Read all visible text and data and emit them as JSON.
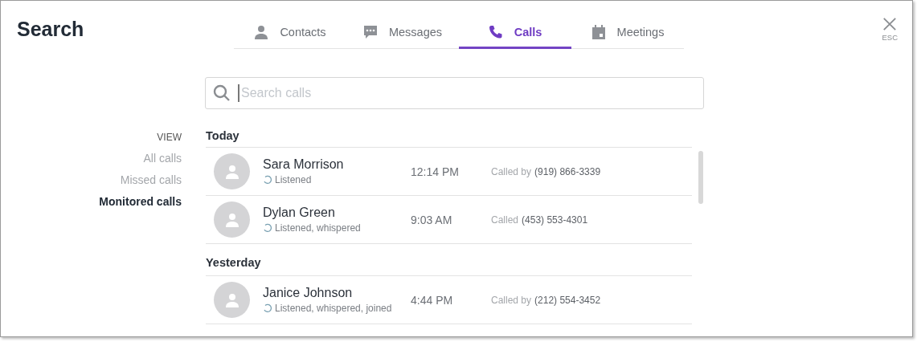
{
  "title": "Search",
  "tabs": [
    {
      "label": "Contacts",
      "kind": "person",
      "selected": false
    },
    {
      "label": "Messages",
      "kind": "chat",
      "selected": false
    },
    {
      "label": "Calls",
      "kind": "phone",
      "selected": true
    },
    {
      "label": "Meetings",
      "kind": "calendar",
      "selected": false
    }
  ],
  "close": {
    "label": "ESC"
  },
  "search": {
    "placeholder": "Search calls"
  },
  "view": {
    "heading": "VIEW",
    "items": [
      {
        "label": "All calls",
        "selected": false
      },
      {
        "label": "Missed calls",
        "selected": false
      },
      {
        "label": "Monitored calls",
        "selected": true
      }
    ]
  },
  "sections": [
    {
      "heading": "Today",
      "calls": [
        {
          "name": "Sara Morrison",
          "status": "Listened",
          "time": "12:14 PM",
          "direction": "Called by",
          "phone": "(919) 866-3339"
        },
        {
          "name": "Dylan Green",
          "status": "Listened, whispered",
          "time": "9:03 AM",
          "direction": "Called",
          "phone": "(453) 553-4301"
        }
      ]
    },
    {
      "heading": "Yesterday",
      "calls": [
        {
          "name": "Janice Johnson",
          "status": "Listened, whispered, joined",
          "time": "4:44 PM",
          "direction": "Called by",
          "phone": "(212) 554-3452"
        }
      ]
    }
  ]
}
